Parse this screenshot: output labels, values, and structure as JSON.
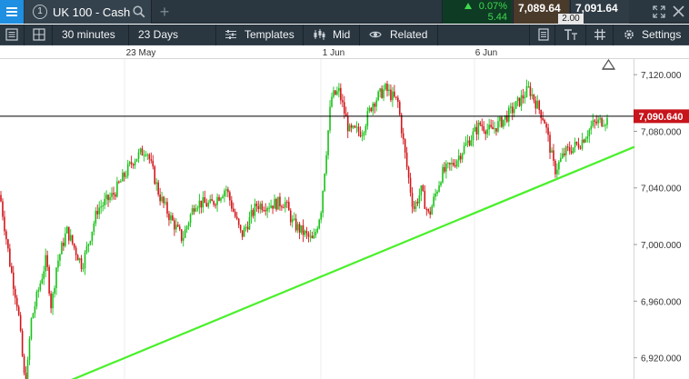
{
  "topbar": {
    "tab_number": "1",
    "instrument": "UK 100 - Cash",
    "add_tab": "+",
    "change_pct": "0.07%",
    "change_abs": "5.44",
    "sell_price": "7,089.64",
    "buy_price": "7,091.64",
    "spread": "2.00"
  },
  "toolbar": {
    "interval": "30 minutes",
    "range": "23 Days",
    "templates": "Templates",
    "price_type": "Mid",
    "related": "Related",
    "settings": "Settings"
  },
  "chart_data": {
    "type": "candlestick",
    "x_labels": [
      "23 May",
      "1 Jun",
      "6 Jun"
    ],
    "y_ticks": [
      "7,120.000",
      "7,080.000",
      "7,040.000",
      "7,000.000",
      "6,960.000",
      "6,920.000"
    ],
    "y_tick_values": [
      7120,
      7080,
      7040,
      7000,
      6960,
      6920
    ],
    "ylim": [
      6905,
      7140
    ],
    "current_price": 7090.64,
    "current_price_label": "7,090.640",
    "trendline": {
      "start_value": 6893,
      "end_value": 7069
    },
    "path_anchors": [
      [
        0,
        7035
      ],
      [
        0.02,
        6985
      ],
      [
        0.035,
        6955
      ],
      [
        0.05,
        6895
      ],
      [
        0.06,
        6945
      ],
      [
        0.075,
        6968
      ],
      [
        0.09,
        6990
      ],
      [
        0.1,
        6955
      ],
      [
        0.11,
        6985
      ],
      [
        0.13,
        7010
      ],
      [
        0.16,
        6985
      ],
      [
        0.19,
        7025
      ],
      [
        0.22,
        7035
      ],
      [
        0.26,
        7060
      ],
      [
        0.285,
        7068
      ],
      [
        0.31,
        7035
      ],
      [
        0.33,
        7020
      ],
      [
        0.355,
        7004
      ],
      [
        0.38,
        7030
      ],
      [
        0.41,
        7028
      ],
      [
        0.44,
        7040
      ],
      [
        0.47,
        7006
      ],
      [
        0.5,
        7028
      ],
      [
        0.52,
        7028
      ],
      [
        0.555,
        7030
      ],
      [
        0.57,
        7015
      ],
      [
        0.61,
        7002
      ],
      [
        0.625,
        7025
      ],
      [
        0.645,
        7104
      ],
      [
        0.66,
        7108
      ],
      [
        0.68,
        7080
      ],
      [
        0.705,
        7080
      ],
      [
        0.725,
        7100
      ],
      [
        0.75,
        7110
      ],
      [
        0.775,
        7100
      ],
      [
        0.79,
        7060
      ],
      [
        0.805,
        7025
      ],
      [
        0.82,
        7038
      ],
      [
        0.835,
        7020
      ],
      [
        0.86,
        7050
      ],
      [
        0.885,
        7058
      ],
      [
        0.91,
        7072
      ],
      [
        0.935,
        7085
      ],
      [
        0.955,
        7080
      ],
      [
        0.98,
        7088
      ],
      [
        1.0,
        7096
      ],
      [
        1.03,
        7110
      ],
      [
        1.06,
        7088
      ],
      [
        1.08,
        7052
      ],
      [
        1.1,
        7065
      ],
      [
        1.13,
        7072
      ],
      [
        1.155,
        7085
      ],
      [
        1.175,
        7088
      ]
    ],
    "colors": {
      "up": "#18c218",
      "down": "#d2161a",
      "trendline": "#49f02a",
      "price_line": "#000000",
      "price_label_bg": "#c8141b",
      "grid": "#ececec"
    }
  }
}
